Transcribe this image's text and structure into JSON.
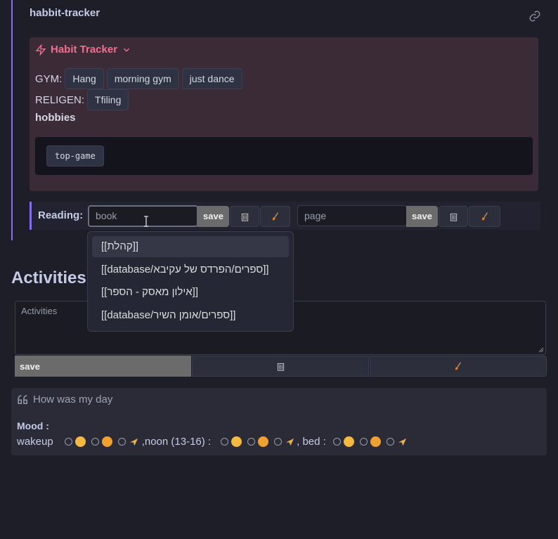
{
  "embed": {
    "title": "habbit-tracker",
    "link_icon": "link-icon"
  },
  "callout": {
    "title": "Habit Tracker",
    "rows": [
      {
        "label": "GYM:",
        "buttons": [
          "Hang",
          "morning gym",
          "just dance"
        ]
      },
      {
        "label": "RELIGEN:",
        "buttons": [
          "Tfiling"
        ]
      }
    ],
    "hobbies_heading": "hobbies",
    "code_button": "top-game"
  },
  "reading": {
    "label": "Reading:",
    "book_placeholder": "book",
    "page_placeholder": "page",
    "save_label": "save"
  },
  "dropdown": {
    "items": [
      "[[קהלת]]",
      "[[database/ספרים/הפרדס של עקיבא]]",
      "[[אילון מאסק - הספר]]",
      "[[database/ספרים/אומן השיר]]"
    ]
  },
  "activities": {
    "heading": "Activities",
    "placeholder": "Activities",
    "save_label": "save"
  },
  "mood": {
    "question": "How was my day",
    "label": "Mood :",
    "wakeup": "wakeup",
    "noon": ",noon (13-16) :",
    "bed": ", bed :"
  },
  "colors": {
    "accent": "#8a6cf0",
    "callout_title": "#f0708f",
    "callout_bg": "#3b2b36"
  }
}
